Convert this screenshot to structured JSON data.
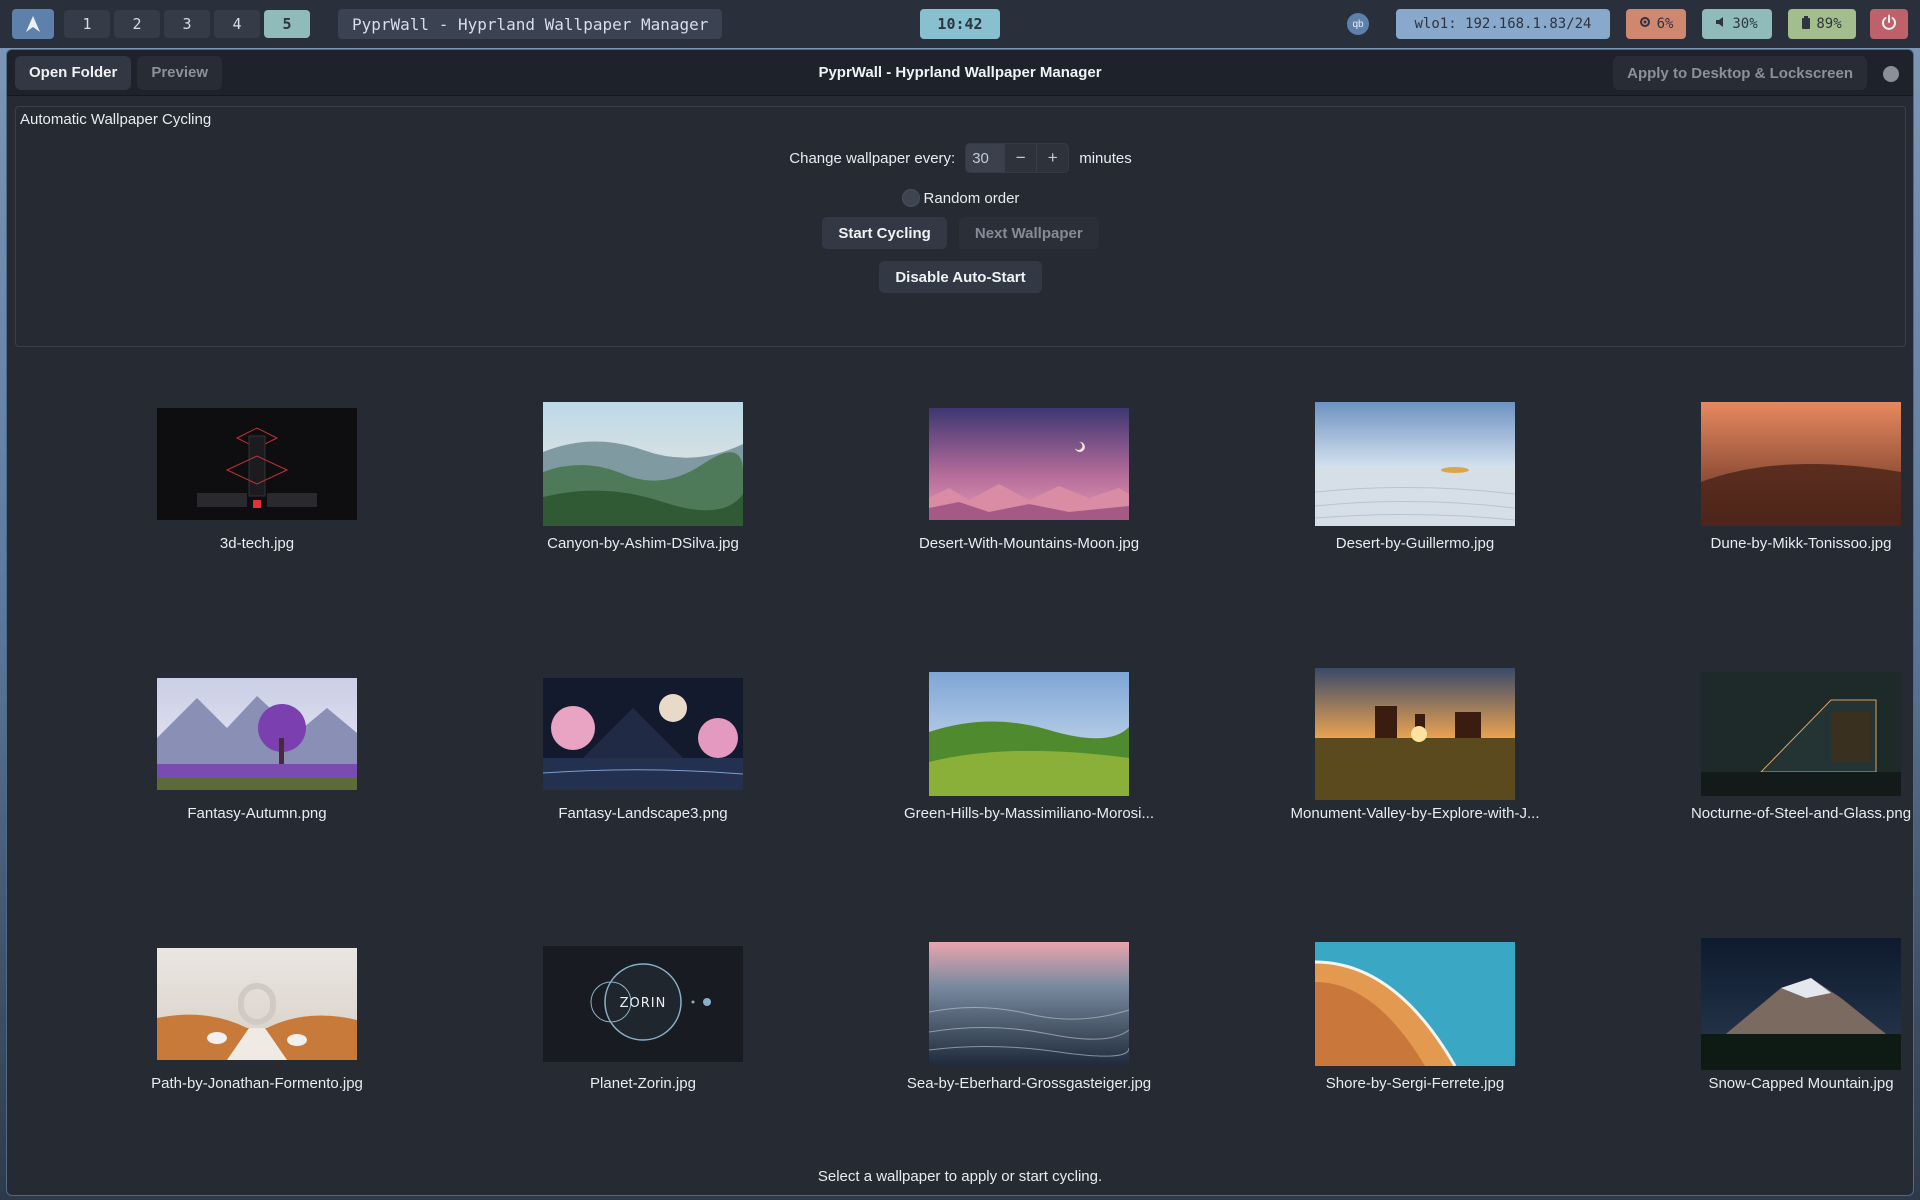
{
  "topbar": {
    "workspaces": [
      "1",
      "2",
      "3",
      "4",
      "5"
    ],
    "active_workspace": "5",
    "window_title": "PyprWall - Hyprland Wallpaper Manager",
    "clock": "10:42",
    "tray_icon_label": "qb",
    "network": "wlo1: 192.168.1.83/24",
    "cpu": "6%",
    "volume": "30%",
    "battery": "89%"
  },
  "header": {
    "open_folder": "Open Folder",
    "preview": "Preview",
    "title": "PyprWall - Hyprland Wallpaper Manager",
    "apply": "Apply to Desktop & Lockscreen"
  },
  "cycling": {
    "frame_title": "Automatic Wallpaper Cycling",
    "interval_label": "Change wallpaper every:",
    "interval_value": "30",
    "minus": "−",
    "plus": "+",
    "unit": "minutes",
    "random_label": "Random order",
    "random_checked": false,
    "start_button": "Start Cycling",
    "next_button": "Next Wallpaper",
    "autostart_button": "Disable Auto-Start"
  },
  "wallpapers": [
    {
      "name": "3d-tech.jpg",
      "theme": "tech"
    },
    {
      "name": "Canyon-by-Ashim-DSilva.jpg",
      "theme": "canyon"
    },
    {
      "name": "Desert-With-Mountains-Moon.jpg",
      "theme": "desertmoon"
    },
    {
      "name": "Desert-by-Guillermo.jpg",
      "theme": "whitesand"
    },
    {
      "name": "Dune-by-Mikk-Tonissoo.jpg",
      "theme": "dune"
    },
    {
      "name": "Fantasy-Autumn.png",
      "theme": "fantasyautumn"
    },
    {
      "name": "Fantasy-Landscape3.png",
      "theme": "fantasyland"
    },
    {
      "name": "Green-Hills-by-Massimiliano-Morosi...",
      "theme": "hills"
    },
    {
      "name": "Monument-Valley-by-Explore-with-J...",
      "theme": "monument"
    },
    {
      "name": "Nocturne-of-Steel-and-Glass.png",
      "theme": "nocturne"
    },
    {
      "name": "Path-by-Jonathan-Formento.jpg",
      "theme": "path"
    },
    {
      "name": "Planet-Zorin.jpg",
      "theme": "zorin",
      "logo_text": "ZORIN"
    },
    {
      "name": "Sea-by-Eberhard-Grossgasteiger.jpg",
      "theme": "sea"
    },
    {
      "name": "Shore-by-Sergi-Ferrete.jpg",
      "theme": "shore"
    },
    {
      "name": "Snow-Capped Mountain.jpg",
      "theme": "snowmountain"
    }
  ],
  "status_text": "Select a wallpaper to apply or start cycling."
}
